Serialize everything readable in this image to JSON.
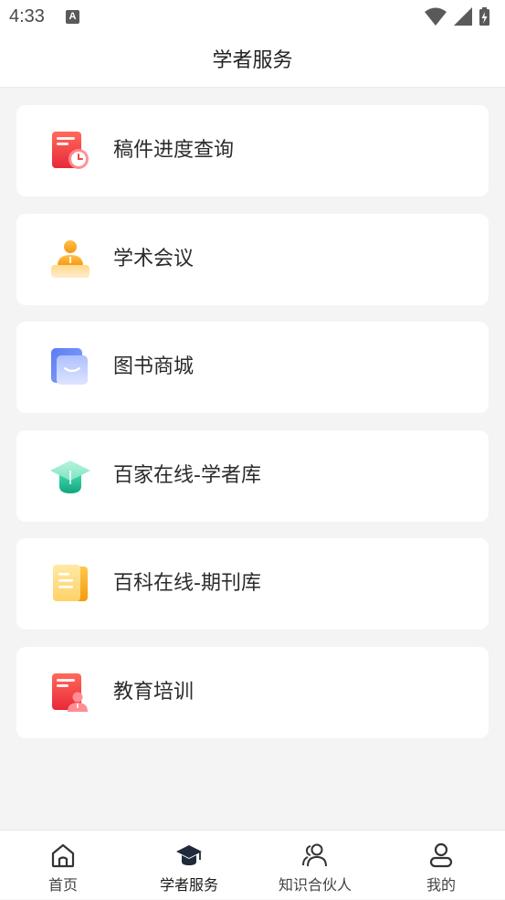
{
  "status_bar": {
    "time": "4:33",
    "notification_letter": "A",
    "icons": [
      "wifi-icon",
      "cellular-signal-icon",
      "battery-charging-icon"
    ]
  },
  "header": {
    "title": "学者服务"
  },
  "menu": {
    "items": [
      {
        "label": "稿件进度查询",
        "icon": "manuscript-progress-icon"
      },
      {
        "label": "学术会议",
        "icon": "academic-meeting-icon"
      },
      {
        "label": "图书商城",
        "icon": "book-mall-icon"
      },
      {
        "label": "百家在线-学者库",
        "icon": "scholar-cap-icon"
      },
      {
        "label": "百科在线-期刊库",
        "icon": "journal-library-icon"
      },
      {
        "label": "教育培训",
        "icon": "education-training-icon"
      }
    ]
  },
  "bottom_nav": {
    "items": [
      {
        "label": "首页",
        "icon": "home-icon",
        "active": false
      },
      {
        "label": "学者服务",
        "icon": "graduation-cap-icon",
        "active": true
      },
      {
        "label": "知识合伙人",
        "icon": "partners-icon",
        "active": false
      },
      {
        "label": "我的",
        "icon": "user-profile-icon",
        "active": false
      }
    ]
  },
  "colors": {
    "background": "#f4f4f4",
    "card": "#ffffff",
    "text_primary": "#2b2b2b",
    "red_icon": "#f04848",
    "orange_icon": "#f7a21b",
    "blue_icon": "#6f8cf5",
    "green_icon": "#1fbf95",
    "yellow_icon": "#f8b72a"
  }
}
